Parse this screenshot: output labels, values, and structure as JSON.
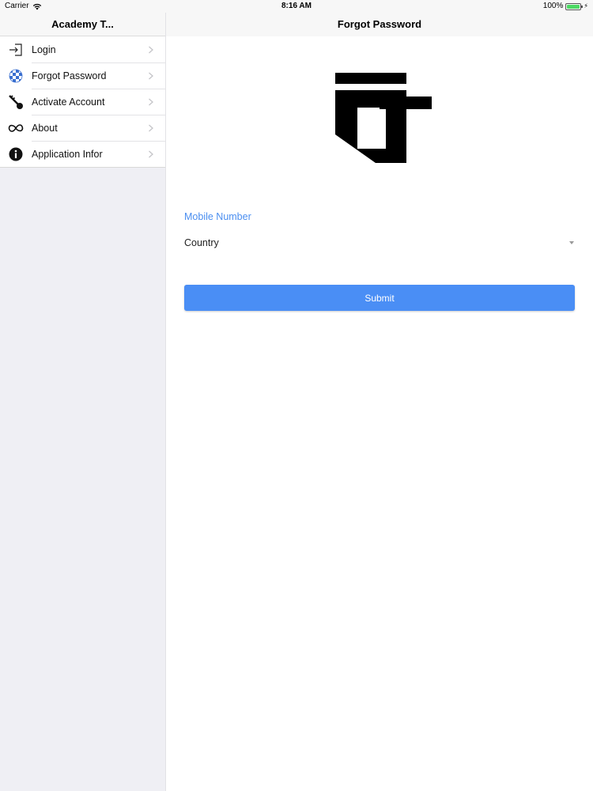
{
  "status_bar": {
    "carrier": "Carrier",
    "time": "8:16 AM",
    "battery_percent_label": "100%",
    "battery_level": 1.0,
    "wifi_icon": "wifi-icon",
    "battery_icon": "battery-icon"
  },
  "sidebar": {
    "title": "Academy T...",
    "items": [
      {
        "label": "Login",
        "icon": "login-arrow-icon"
      },
      {
        "label": "Forgot Password",
        "icon": "checkered-ball-icon"
      },
      {
        "label": "Activate Account",
        "icon": "key-icon"
      },
      {
        "label": "About",
        "icon": "infinity-icon"
      },
      {
        "label": "Application Infor",
        "icon": "info-circle-icon"
      }
    ],
    "chevron_icon": "chevron-right-icon"
  },
  "main": {
    "title": "Forgot Password",
    "logo_icon": "app-logo-icon",
    "mobile_label": "Mobile Number",
    "country_value": "Country",
    "submit_label": "Submit"
  },
  "colors": {
    "accent": "#4a8ef5",
    "label_blue": "#4a8ef0",
    "sidebar_bg": "#efeff4",
    "battery_green": "#4cd964"
  }
}
